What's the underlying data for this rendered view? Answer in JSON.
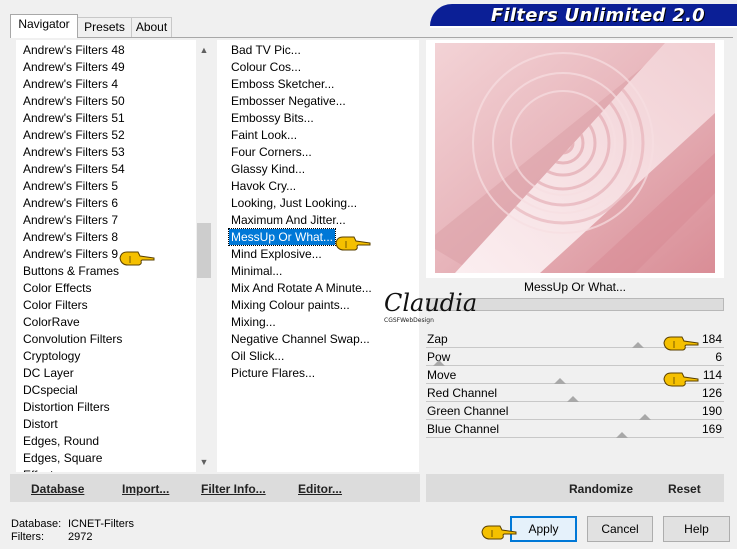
{
  "tabs": [
    "Navigator",
    "Presets",
    "About"
  ],
  "banner_title": "Filters Unlimited 2.0",
  "categories": [
    "Andrew's Filters 48",
    "Andrew's Filters 49",
    "Andrew's Filters 4",
    "Andrew's Filters 50",
    "Andrew's Filters 51",
    "Andrew's Filters 52",
    "Andrew's Filters 53",
    "Andrew's Filters 54",
    "Andrew's Filters 5",
    "Andrew's Filters 6",
    "Andrew's Filters 7",
    "Andrew's Filters 8",
    "Andrew's Filters 9",
    "Buttons & Frames",
    "Color Effects",
    "Color Filters",
    "ColorRave",
    "Convolution Filters",
    "Cryptology",
    "DC Layer",
    "DCspecial",
    "Distortion Filters",
    "Distort",
    "Edges, Round",
    "Edges, Square",
    "Effects"
  ],
  "filters": [
    "Bad TV Pic...",
    "Colour Cos...",
    "Emboss Sketcher...",
    "Embosser Negative...",
    "Embossy Bits...",
    "Faint Look...",
    "Four Corners...",
    "Glassy Kind...",
    "Havok Cry...",
    "Looking, Just Looking...",
    "Maximum And Jitter...",
    "MessUp Or What...",
    "Mind Explosive...",
    "Minimal...",
    "Mix And Rotate A Minute...",
    "Mixing Colour paints...",
    "Mixing...",
    "Negative Channel Swap...",
    "Oil Slick...",
    "Picture Flares..."
  ],
  "selected_filter_index": 11,
  "selected_filter_name": "MessUp Or What...",
  "signature": {
    "name": "Claudia",
    "sub": "CGSFWebDesign"
  },
  "params": [
    {
      "label": "Zap",
      "value": "184",
      "level": 184
    },
    {
      "label": "Pow",
      "value": "6",
      "level": 6
    },
    {
      "label": "Move",
      "value": "114",
      "level": 114
    },
    {
      "label": "Red Channel",
      "value": "126",
      "level": 126
    },
    {
      "label": "Green Channel",
      "value": "190",
      "level": 190
    },
    {
      "label": "Blue Channel",
      "value": "169",
      "level": 169
    }
  ],
  "param_max": 255,
  "bottom_links": {
    "database": "Database",
    "import": "Import...",
    "filter_info": "Filter Info...",
    "editor": "Editor...",
    "randomize": "Randomize",
    "reset": "Reset"
  },
  "status": {
    "database_label": "Database:",
    "database_value": "ICNET-Filters",
    "filters_label": "Filters:",
    "filters_value": "2972"
  },
  "buttons": {
    "apply": "Apply",
    "cancel": "Cancel",
    "help": "Help"
  },
  "colors": {
    "banner": "#0b1f96",
    "selection": "#0078d7",
    "preview_pink": "#e8bcc1",
    "hand": "#f5c000"
  }
}
